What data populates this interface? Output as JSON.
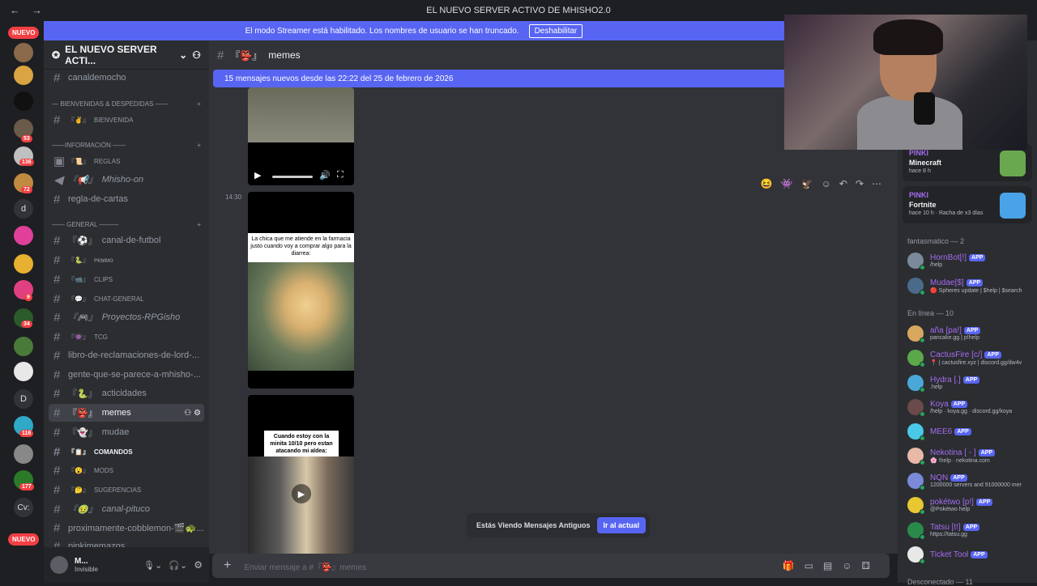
{
  "window": {
    "title": "EL NUEVO SERVER ACTIVO DE MHISHO2.0"
  },
  "streamer_banner": {
    "text": "El modo Streamer está habilitado. Los nombres de usuario se han truncado.",
    "button": "Deshabilitar"
  },
  "guilds": {
    "nuevo_top": "NUEVO",
    "nuevo_bottom": "NUEVO",
    "badges": [
      "53",
      "136",
      "72",
      "9",
      "34",
      "116",
      "177"
    ],
    "letters": [
      "d",
      "D",
      "Cv:"
    ]
  },
  "server": {
    "name": "EL NUEVO SERVER ACTI..."
  },
  "channels": [
    {
      "label": "canaldemocho",
      "style": "normal"
    },
    {
      "label": "BIENVENIDA",
      "prefix": "『✌』",
      "style": "small"
    },
    {
      "label": "REGLAS",
      "prefix": "『📜』",
      "style": "small"
    },
    {
      "label": "Mhisho-on",
      "prefix": "『📢』",
      "style": "italic"
    },
    {
      "label": "regla-de-cartas",
      "style": "normal"
    },
    {
      "label": "canal-de-futbol",
      "prefix": "『⚽』",
      "style": "normal"
    },
    {
      "label": "ᴘᴋᴍᴍᴏ",
      "prefix": "『🐍』",
      "style": "small"
    },
    {
      "label": "CLIPS",
      "prefix": "『📹』",
      "style": "small"
    },
    {
      "label": "CHAT-GENERAL",
      "prefix": "『💬』",
      "style": "small"
    },
    {
      "label": "Proyectos-RPGisho",
      "prefix": "『🎮』",
      "style": "italic"
    },
    {
      "label": "TCG",
      "prefix": "『👾』",
      "style": "small"
    },
    {
      "label": "libro-de-reclamaciones-de-lord-...",
      "style": "normal"
    },
    {
      "label": "gente-que-se-parece-a-mhisho-...",
      "style": "normal"
    },
    {
      "label": "acticidades",
      "prefix": "『🐍』",
      "style": "normal"
    },
    {
      "label": "memes",
      "prefix": "『👺』",
      "style": "active"
    },
    {
      "label": "mudae",
      "prefix": "『👻』",
      "style": "normal"
    },
    {
      "label": "COMANDOS",
      "prefix": "『📋』",
      "style": "boldsmall"
    },
    {
      "label": "MODS",
      "prefix": "『😮』",
      "style": "small"
    },
    {
      "label": "SUGERENCIAS",
      "prefix": "『🤔』",
      "style": "small"
    },
    {
      "label": "canal-pituco",
      "prefix": "『🤢』",
      "style": "italic"
    },
    {
      "label": "proximamente-cobblemon-🎬🐢...",
      "style": "normal"
    },
    {
      "label": "pinkimemazos",
      "style": "normal"
    }
  ],
  "categories": [
    {
      "label": "— BIENVENIDAS & DESPEDIDAS ——"
    },
    {
      "label": "——INFORMACIÓN ——"
    },
    {
      "label": "—— GENERAL ———"
    }
  ],
  "user": {
    "name": "M...",
    "status": "Invisible"
  },
  "channel_header": {
    "name": "memes",
    "prefix": "『👺』"
  },
  "new_messages": "15 mensajes nuevos desde las 22:22 del 25 de febrero de 2026",
  "message": {
    "time": "14:30"
  },
  "meme1": {
    "caption": "La chica que me atiende en la farmacia justo cuando voy a comprar algo para la diarrea:"
  },
  "meme2": {
    "caption": "Cuando estoy con la minita 10/10 pero estan atacando mi aldea:"
  },
  "old_messages": {
    "text": "Estás Viendo Mensajes Antiguos",
    "button": "Ir al actual"
  },
  "composer": {
    "placeholder": "Enviar mensaje a #『👺』memes"
  },
  "activities": [
    {
      "who": "PINKI",
      "game": "Minecraft",
      "sub": "hace 8 h",
      "color": "#6aa84f"
    },
    {
      "who": "PINKI",
      "game": "Fortnite",
      "sub": "hace 10 h  · Racha de x3 días",
      "color": "#4aa3e8"
    }
  ],
  "member_sections": [
    {
      "label": "fantasmatico — 2"
    },
    {
      "label": "En línea — 10"
    },
    {
      "label": "Desconectado — 11"
    }
  ],
  "members_fantasmatico": [
    {
      "name": "HornBot[!]",
      "status": "/help"
    },
    {
      "name": "Mudae[$]",
      "status": "🔴 Spheres update | $help | $search"
    }
  ],
  "members_online": [
    {
      "name": "aña [pa!]",
      "status": "pancake.gg | p!help"
    },
    {
      "name": "CactusFire [c/]",
      "status": "📍 | cactusfire.xyz | discord.gg/dw4v"
    },
    {
      "name": "Hydra [.]",
      "status": ".help"
    },
    {
      "name": "Koya",
      "status": "/help · koya.gg · discord.gg/koya"
    },
    {
      "name": "MEE6",
      "status": ""
    },
    {
      "name": "Nekotina [ - ]",
      "status": "🌸 !help · nekotina.com"
    },
    {
      "name": "NQN",
      "status": "1200000 servers and 91000000 mer"
    },
    {
      "name": "pokétwo [p!]",
      "status": "@Pokétwo help"
    },
    {
      "name": "Tatsu [t!]",
      "status": "https://tatsu.gg"
    },
    {
      "name": "Ticket Tool",
      "status": ""
    }
  ],
  "app_label": "APP"
}
